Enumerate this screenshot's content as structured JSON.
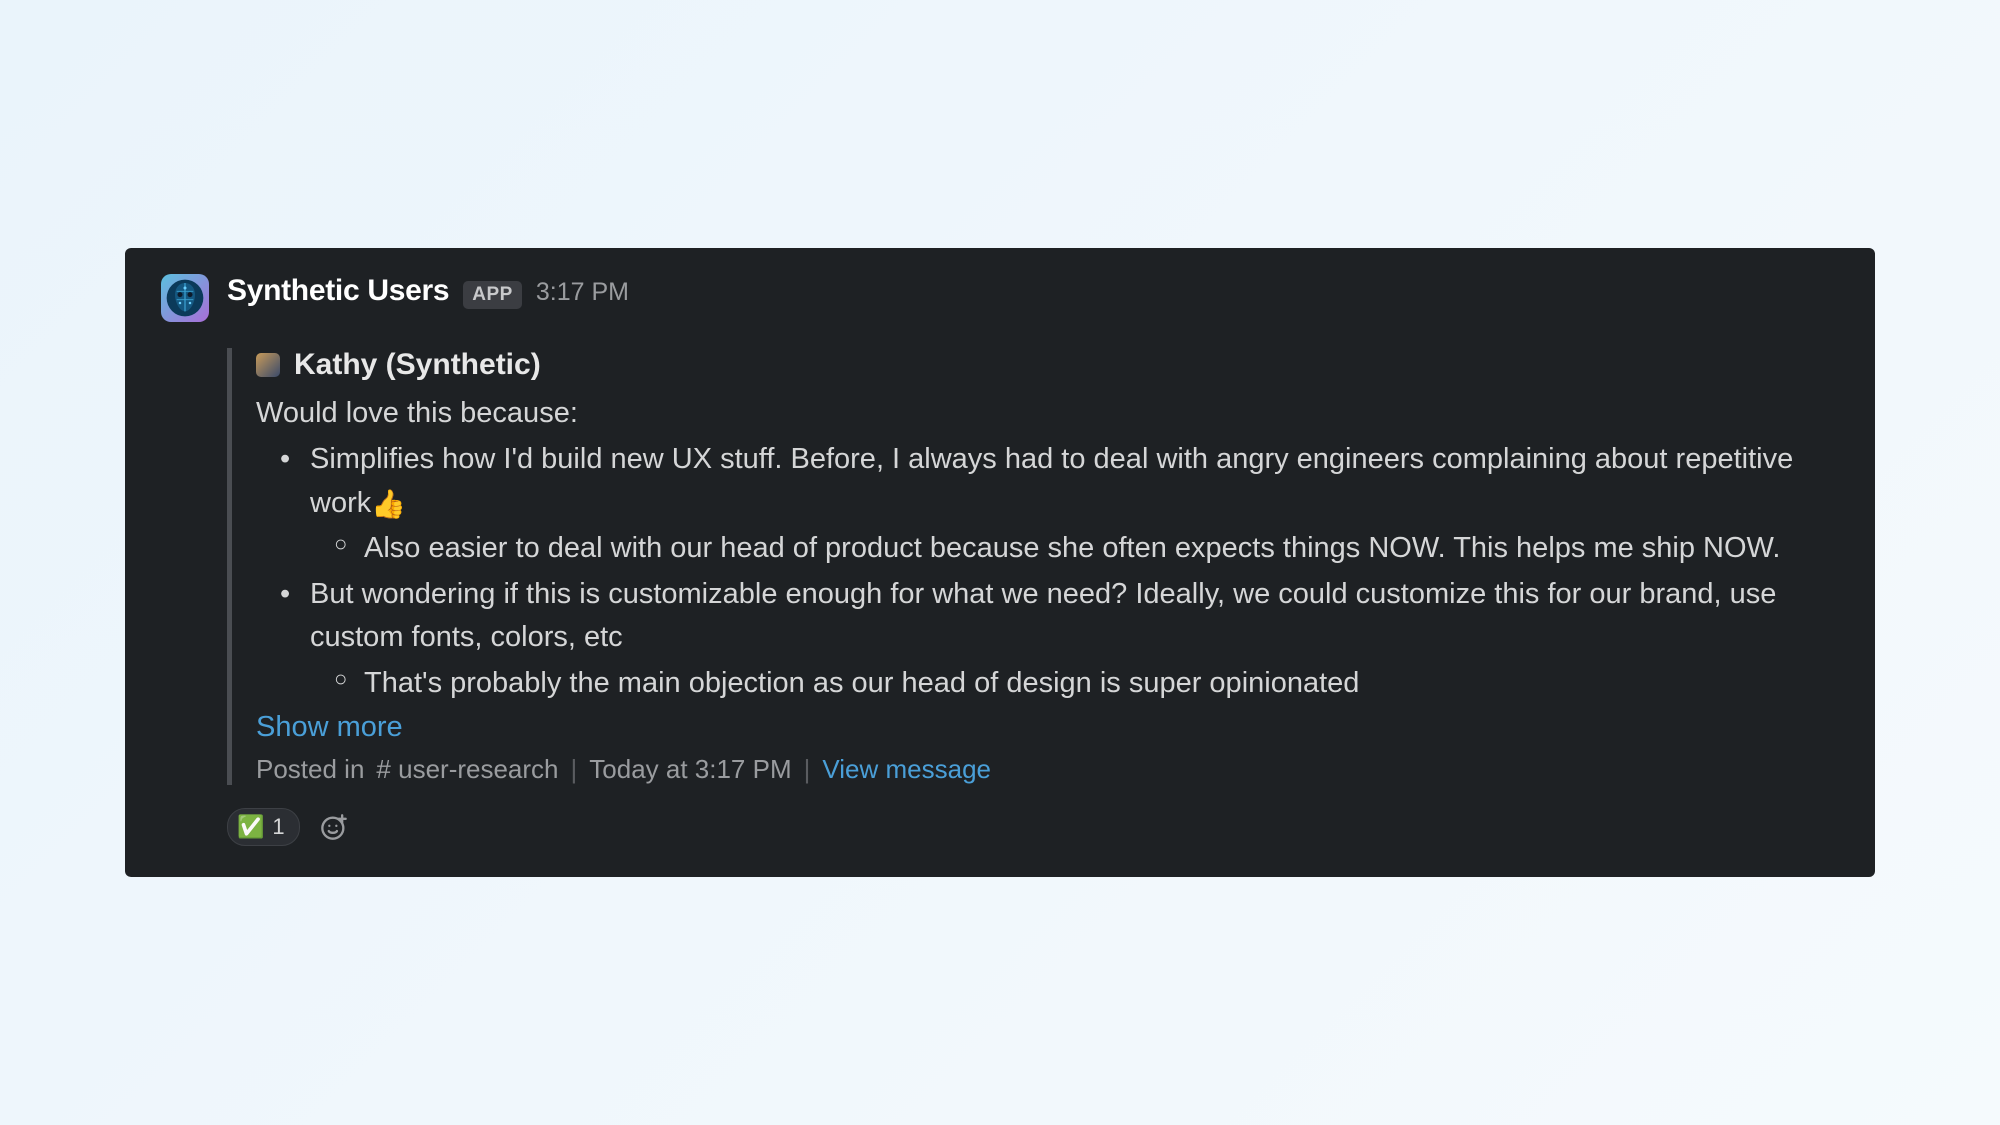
{
  "header": {
    "app_name": "Synthetic Users",
    "app_badge": "APP",
    "timestamp": "3:17 PM"
  },
  "quote": {
    "author": "Kathy (Synthetic)",
    "intro": "Would love this because:",
    "bullets": [
      {
        "text": "Simplifies how I'd build new UX stuff. Before, I always had to deal with angry engineers complaining about repetitive work",
        "emoji": "👍",
        "sub": [
          "Also easier to deal with our head of product because she often expects things NOW. This helps me ship NOW."
        ]
      },
      {
        "text": "But wondering if this is customizable enough for what we need? Ideally, we could customize this for our brand, use custom fonts, colors, etc",
        "sub": [
          "That's probably the main objection as our head of design is super opinionated"
        ]
      }
    ],
    "show_more": "Show more",
    "footer": {
      "posted_in_prefix": "Posted in",
      "channel_hash": "#",
      "channel_name": "user-research",
      "when": "Today at 3:17 PM",
      "view_label": "View message"
    }
  },
  "reactions": {
    "items": [
      {
        "emoji": "✅",
        "count": "1"
      }
    ]
  }
}
